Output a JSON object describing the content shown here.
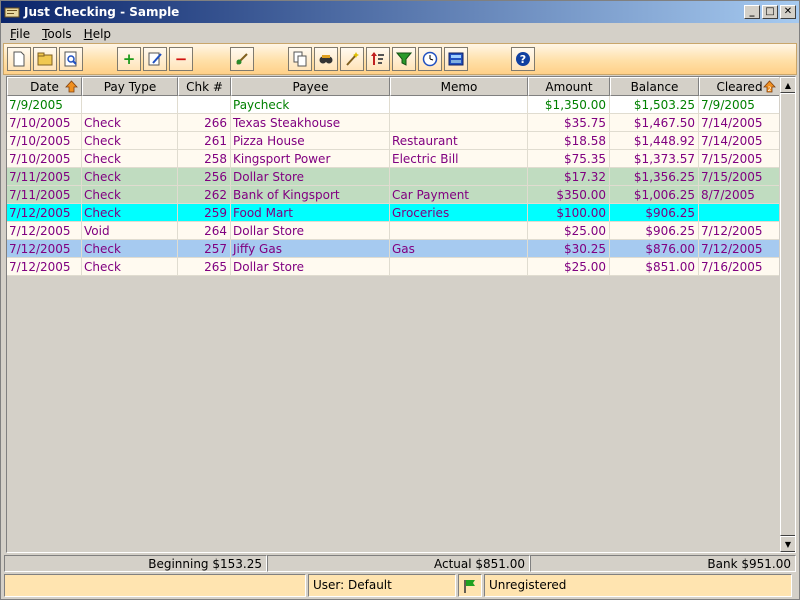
{
  "window": {
    "title": "Just Checking - Sample"
  },
  "menu": [
    {
      "label": "File"
    },
    {
      "label": "Tools"
    },
    {
      "label": "Help"
    }
  ],
  "columns": [
    "Date",
    "Pay Type",
    "Chk #",
    "Payee",
    "Memo",
    "Amount",
    "Balance",
    "Cleared"
  ],
  "colors": {
    "green_text": "#008000",
    "purple_text": "#800080",
    "row_light": "#fffaf0",
    "row_green": "#c0dcc0",
    "row_cyan": "#00ffff",
    "row_blue": "#a6caf0"
  },
  "rows": [
    {
      "date": "7/9/2005",
      "type": "",
      "chk": "",
      "payee": "Paycheck",
      "memo": "",
      "amount": "$1,350.00",
      "balance": "$1,503.25",
      "cleared": "7/9/2005",
      "style": "green"
    },
    {
      "date": "7/10/2005",
      "type": "Check",
      "chk": "266",
      "payee": "Texas Steakhouse",
      "memo": "",
      "amount": "$35.75",
      "balance": "$1,467.50",
      "cleared": "7/14/2005",
      "style": "light"
    },
    {
      "date": "7/10/2005",
      "type": "Check",
      "chk": "261",
      "payee": "Pizza House",
      "memo": "Restaurant",
      "amount": "$18.58",
      "balance": "$1,448.92",
      "cleared": "7/14/2005",
      "style": "light"
    },
    {
      "date": "7/10/2005",
      "type": "Check",
      "chk": "258",
      "payee": "Kingsport Power",
      "memo": "Electric Bill",
      "amount": "$75.35",
      "balance": "$1,373.57",
      "cleared": "7/15/2005",
      "style": "light"
    },
    {
      "date": "7/11/2005",
      "type": "Check",
      "chk": "256",
      "payee": "Dollar Store",
      "memo": "",
      "amount": "$17.32",
      "balance": "$1,356.25",
      "cleared": "7/15/2005",
      "style": "greenbg"
    },
    {
      "date": "7/11/2005",
      "type": "Check",
      "chk": "262",
      "payee": "Bank of Kingsport",
      "memo": "Car Payment",
      "amount": "$350.00",
      "balance": "$1,006.25",
      "cleared": "8/7/2005",
      "style": "greenbg"
    },
    {
      "date": "7/12/2005",
      "type": "Check",
      "chk": "259",
      "payee": "Food Mart",
      "memo": "Groceries",
      "amount": "$100.00",
      "balance": "$906.25",
      "cleared": "",
      "style": "cyan"
    },
    {
      "date": "7/12/2005",
      "type": "Void",
      "chk": "264",
      "payee": "Dollar Store",
      "memo": "",
      "amount": "$25.00",
      "balance": "$906.25",
      "cleared": "7/12/2005",
      "style": "light"
    },
    {
      "date": "7/12/2005",
      "type": "Check",
      "chk": "257",
      "payee": "Jiffy Gas",
      "memo": "Gas",
      "amount": "$30.25",
      "balance": "$876.00",
      "cleared": "7/12/2005",
      "style": "blue"
    },
    {
      "date": "7/12/2005",
      "type": "Check",
      "chk": "265",
      "payee": "Dollar Store",
      "memo": "",
      "amount": "$25.00",
      "balance": "$851.00",
      "cleared": "7/16/2005",
      "style": "light"
    }
  ],
  "totals": {
    "beginning": "Beginning $153.25",
    "actual": "Actual $851.00",
    "bank": "Bank $951.00"
  },
  "status": {
    "left": "",
    "user": "User: Default",
    "registration": "Unregistered"
  },
  "toolbar_icons": [
    "new-file-icon",
    "open-folder-icon",
    "print-preview-icon",
    "add-icon",
    "edit-icon",
    "delete-icon",
    "clear-icon",
    "copy-icon",
    "find-icon",
    "wizard-icon",
    "sort-icon",
    "filter-icon",
    "clock-icon",
    "calculator-icon",
    "help-icon"
  ]
}
